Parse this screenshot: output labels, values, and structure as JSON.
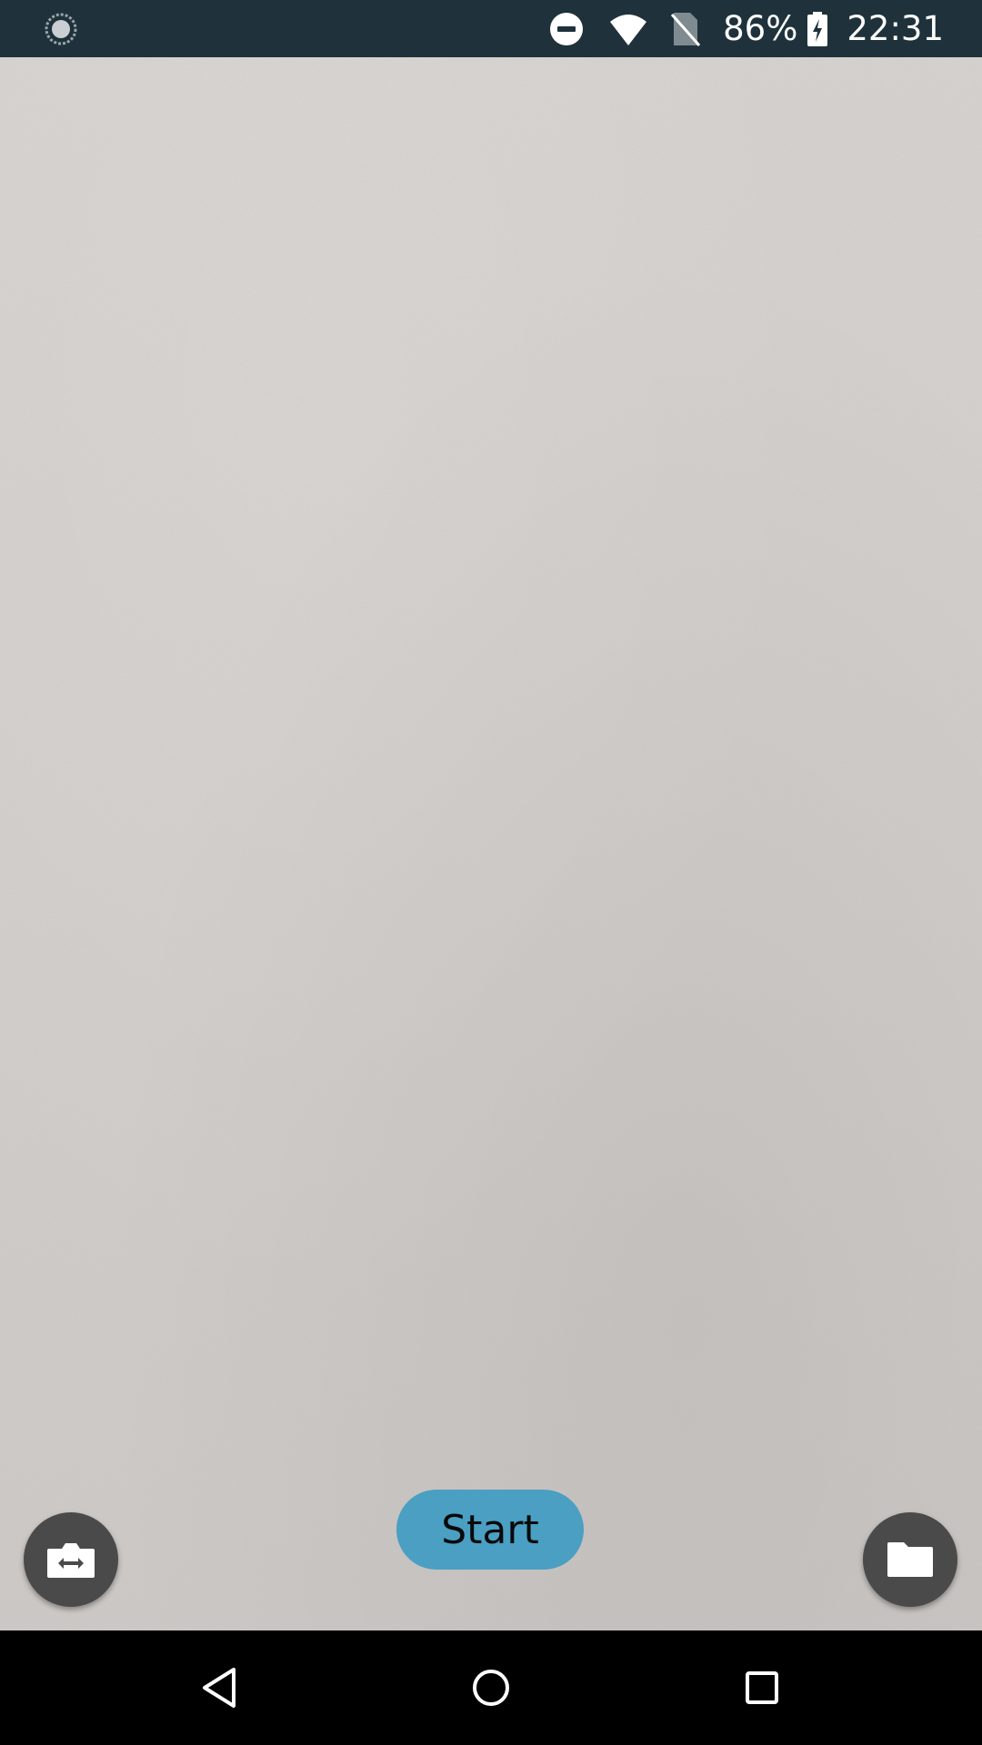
{
  "status_bar": {
    "battery_percent": "86%",
    "time": "22:31",
    "icons": [
      "sync-icon",
      "do-not-disturb-icon",
      "wifi-icon",
      "no-sim-icon",
      "battery-charging-icon"
    ]
  },
  "camera": {
    "start_label": "Start",
    "accent_color": "#4a9fc2"
  },
  "controls": {
    "left_icon": "switch-camera-icon",
    "right_icon": "folder-icon"
  },
  "nav_bar": {
    "icons": [
      "back-icon",
      "home-icon",
      "recents-icon"
    ]
  }
}
